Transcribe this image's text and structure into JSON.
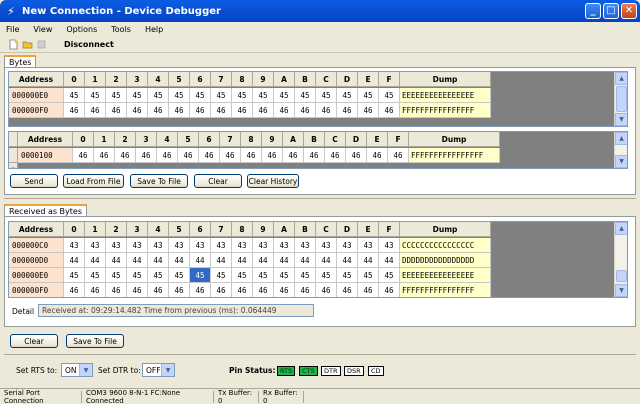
{
  "window": {
    "title": "New Connection - Device Debugger"
  },
  "menu": [
    "File",
    "View",
    "Options",
    "Tools",
    "Help"
  ],
  "toolbar": {
    "disconnect": "Disconnect"
  },
  "tabs": {
    "bytes": "Bytes",
    "received": "Received as Bytes"
  },
  "columns": [
    "Address",
    "0",
    "1",
    "2",
    "3",
    "4",
    "5",
    "6",
    "7",
    "8",
    "9",
    "A",
    "B",
    "C",
    "D",
    "E",
    "F",
    "Dump"
  ],
  "top_grid": [
    {
      "addr": "000000E0",
      "cells": [
        "45",
        "45",
        "45",
        "45",
        "45",
        "45",
        "45",
        "45",
        "45",
        "45",
        "45",
        "45",
        "45",
        "45",
        "45",
        "45"
      ],
      "dump": "EEEEEEEEEEEEEEEE"
    },
    {
      "addr": "000000F0",
      "cells": [
        "46",
        "46",
        "46",
        "46",
        "46",
        "46",
        "46",
        "46",
        "46",
        "46",
        "46",
        "46",
        "46",
        "46",
        "46",
        "46"
      ],
      "dump": "FFFFFFFFFFFFFFFF"
    }
  ],
  "send_grid": [
    {
      "marker": "",
      "addr": "0000100",
      "cells": [
        "46",
        "46",
        "46",
        "46",
        "46",
        "46",
        "46",
        "46",
        "46",
        "46",
        "46",
        "46",
        "46",
        "46",
        "46",
        "46"
      ],
      "dump": "FFFFFFFFFFFFFFFF"
    }
  ],
  "send_buttons": {
    "send": "Send",
    "load": "Load From File",
    "save": "Save To File",
    "clear": "Clear",
    "clear_history": "Clear History"
  },
  "recv_grid": [
    {
      "addr": "000000C0",
      "cells": [
        "43",
        "43",
        "43",
        "43",
        "43",
        "43",
        "43",
        "43",
        "43",
        "43",
        "43",
        "43",
        "43",
        "43",
        "43",
        "43"
      ],
      "dump": "CCCCCCCCCCCCCCCC"
    },
    {
      "addr": "000000D0",
      "cells": [
        "44",
        "44",
        "44",
        "44",
        "44",
        "44",
        "44",
        "44",
        "44",
        "44",
        "44",
        "44",
        "44",
        "44",
        "44",
        "44"
      ],
      "dump": "DDDDDDDDDDDDDDDD"
    },
    {
      "addr": "000000E0",
      "cells": [
        "45",
        "45",
        "45",
        "45",
        "45",
        "45",
        "45",
        "45",
        "45",
        "45",
        "45",
        "45",
        "45",
        "45",
        "45",
        "45"
      ],
      "dump": "EEEEEEEEEEEEEEEE",
      "selected": 6
    },
    {
      "addr": "000000F0",
      "cells": [
        "46",
        "46",
        "46",
        "46",
        "46",
        "46",
        "46",
        "46",
        "46",
        "46",
        "46",
        "46",
        "46",
        "46",
        "46",
        "46"
      ],
      "dump": "FFFFFFFFFFFFFFFF"
    }
  ],
  "detail": {
    "label": "Detail",
    "value": "Received at: 09:29:14.482 Time from previous (ms): 0.064449"
  },
  "recv_buttons": {
    "clear": "Clear",
    "save": "Save To File"
  },
  "controls": {
    "rts_label": "Set RTS to:",
    "rts_value": "ON",
    "dtr_label": "Set DTR to:",
    "dtr_value": "OFF",
    "pin_status_label": "Pin Status:"
  },
  "pins": [
    {
      "name": "RTS",
      "on": true
    },
    {
      "name": "CTS",
      "on": true
    },
    {
      "name": "DTR",
      "on": false
    },
    {
      "name": "DSR",
      "on": false
    },
    {
      "name": "CD",
      "on": false
    }
  ],
  "statusbar": {
    "conn": "Serial Port Connection",
    "port": "COM3 9600 8-N-1 FC:None Connected",
    "tx": "Tx Buffer: 0",
    "rx": "Rx Buffer: 0"
  },
  "colors": {
    "titlebar": "#0a5ee4",
    "address_bg": "#fbe3cf",
    "dump_bg": "#ffffc8",
    "selection": "#316ac5",
    "pin_on": "#22b14c"
  }
}
